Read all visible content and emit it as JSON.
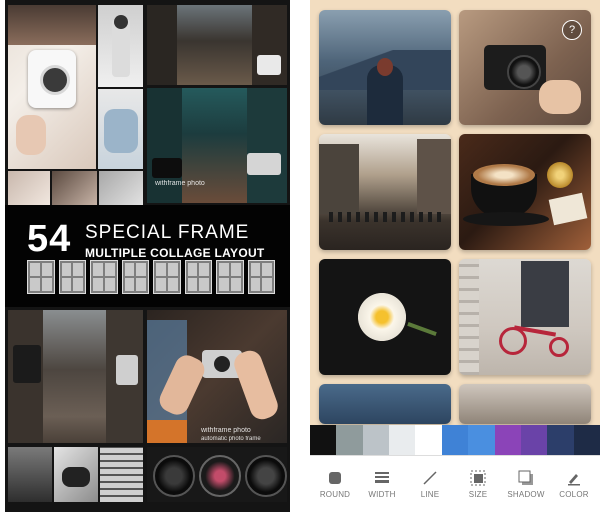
{
  "left_screen": {
    "banner": {
      "number": "54",
      "title": "SPECIAL FRAME",
      "subtitle": "MULTIPLE COLLAGE LAYOUT"
    },
    "watermarks": {
      "top": "withframe photo",
      "bottom": "withframe photo",
      "bottom_sub": "automatic photo frame"
    }
  },
  "right_screen": {
    "help_icon": "?",
    "palette_colors": [
      "#111111",
      "#8f9b9c",
      "#bcc3c8",
      "#e9ecee",
      "#ffffff",
      "#3f82d6",
      "#4a8fe0",
      "#8b44b8",
      "#6a43a8",
      "#2c3e6a",
      "#1e2b46"
    ],
    "toolbar": {
      "round": "ROUND",
      "width": "WIDTH",
      "line": "LINE",
      "size": "SIZE",
      "shadow": "SHADOW",
      "color": "COLOR"
    }
  }
}
